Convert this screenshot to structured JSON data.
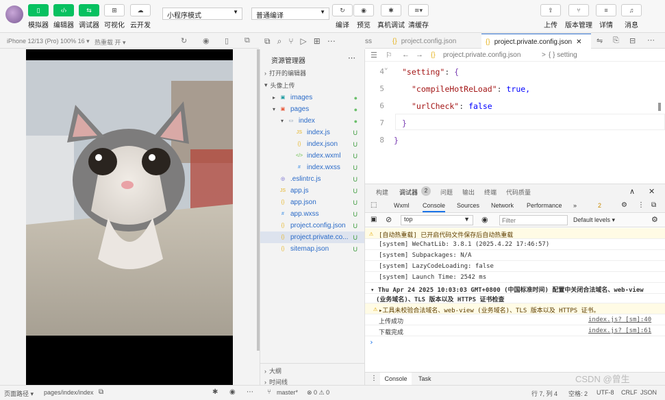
{
  "toolbar": {
    "buttons": [
      {
        "label": "模拟器"
      },
      {
        "label": "编辑器"
      },
      {
        "label": "调试器"
      },
      {
        "label": "可视化"
      },
      {
        "label": "云开发"
      }
    ],
    "mode_select": "小程序模式",
    "compile_select": "普通编译",
    "actions": [
      {
        "label": "编译"
      },
      {
        "label": "预览"
      },
      {
        "label": "真机调试"
      },
      {
        "label": "清缓存"
      }
    ],
    "right": [
      {
        "label": "上传"
      },
      {
        "label": "版本管理"
      },
      {
        "label": "详情"
      },
      {
        "label": "消息"
      }
    ]
  },
  "simulator": {
    "device": "iPhone 12/13 (Pro) 100% 16 ▾",
    "hotreload": "热重载 开 ▾"
  },
  "explorer": {
    "title": "资源管理器",
    "open_editors": "打开的编辑器",
    "project": "头像上传",
    "items": [
      {
        "name": "images",
        "status": "●",
        "icon": "▣",
        "color": "#1b9aa0"
      },
      {
        "name": "pages",
        "status": "●",
        "icon": "▣",
        "color": "#e8593a"
      },
      {
        "name": "index",
        "status": "●",
        "icon": "▭",
        "color": "#7a8fa6"
      },
      {
        "name": "index.js",
        "status": "U",
        "icon": "JS",
        "color": "#e6b422"
      },
      {
        "name": "index.json",
        "status": "U",
        "icon": "{}",
        "color": "#e6b422"
      },
      {
        "name": "index.wxml",
        "status": "U",
        "icon": "</>",
        "color": "#6abf4b"
      },
      {
        "name": "index.wxss",
        "status": "U",
        "icon": "#",
        "color": "#3c8ee5"
      },
      {
        "name": ".eslintrc.js",
        "status": "U",
        "icon": "◎",
        "color": "#5a4fc8"
      },
      {
        "name": "app.js",
        "status": "U",
        "icon": "JS",
        "color": "#e6b422"
      },
      {
        "name": "app.json",
        "status": "U",
        "icon": "{}",
        "color": "#e6b422"
      },
      {
        "name": "app.wxss",
        "status": "U",
        "icon": "#",
        "color": "#3c8ee5"
      },
      {
        "name": "project.config.json",
        "status": "U",
        "icon": "{}",
        "color": "#e6b422"
      },
      {
        "name": "project.private.co...",
        "status": "U",
        "icon": "{}",
        "color": "#e6b422"
      },
      {
        "name": "sitemap.json",
        "status": "U",
        "icon": "{}",
        "color": "#e6b422"
      }
    ],
    "outline": "大纲",
    "timeline": "时间线"
  },
  "editor": {
    "tab_prev": "ss",
    "tab1": "project.config.json",
    "tab2": "project.private.config.json",
    "crumb_file": "project.private.config.json",
    "crumb_sep": ">",
    "crumb_node": "{ } setting",
    "lines": [
      {
        "n": "4",
        "t1": "\"setting\"",
        "t2": ": ",
        "t3": "{"
      },
      {
        "n": "5",
        "t1": "\"compileHotReLoad\"",
        "t2": ": ",
        "t3": "true,"
      },
      {
        "n": "6",
        "t1": "\"urlCheck\"",
        "t2": ": ",
        "t3": "false"
      },
      {
        "n": "7",
        "t1": "",
        "t2": "",
        "t3": "}"
      },
      {
        "n": "8",
        "t1": "",
        "t2": "",
        "t3": "}"
      }
    ]
  },
  "devtools": {
    "tabs": [
      "构建",
      "调试器",
      "问题",
      "输出",
      "终端",
      "代码质量"
    ],
    "badge": "2",
    "subtabs": [
      "Wxml",
      "Console",
      "Sources",
      "Network",
      "Performance",
      "»"
    ],
    "warn_count": "2",
    "context": "top",
    "filter_placeholder": "Filter",
    "levels": "Default levels ▾",
    "logs": [
      "[自动热重载] 已开启代码文件保存后自动热重载",
      "[system] WeChatLib: 3.8.1 (2025.4.22 17:46:57)",
      "[system] Subpackages: N/A",
      "[system] LazyCodeLoading: false",
      "[system] Launch Time: 2542 ms"
    ],
    "group1": "▾ Thu Apr 24 2025 10:03:03 GMT+0800 (中国标准时间) 配置中关闭合法域名、web-view",
    "group2": "  (业务域名)、TLS 版本以及 HTTPS 证书检查",
    "warn_line": "▸工具未校验合法域名、web-view (业务域名)、TLS 版本以及 HTTPS 证书。",
    "msg1": "上传成功",
    "src1": "index.js? [sm]:40",
    "msg2": "下载完成",
    "src2": "index.js? [sm]:61",
    "prompt": "›",
    "bottom_tabs": [
      "Console",
      "Task"
    ]
  },
  "statusbar": {
    "path": "页面路径 ▾",
    "page": "pages/index/index",
    "branch": "master*",
    "errors": "⊗ 0 ⚠ 0",
    "pos": "行 7, 列 4",
    "spaces": "空格: 2",
    "encoding": "UTF-8",
    "eol": "CRLF",
    "lang": "JSON",
    "watermark": "CSDN @曾生"
  }
}
